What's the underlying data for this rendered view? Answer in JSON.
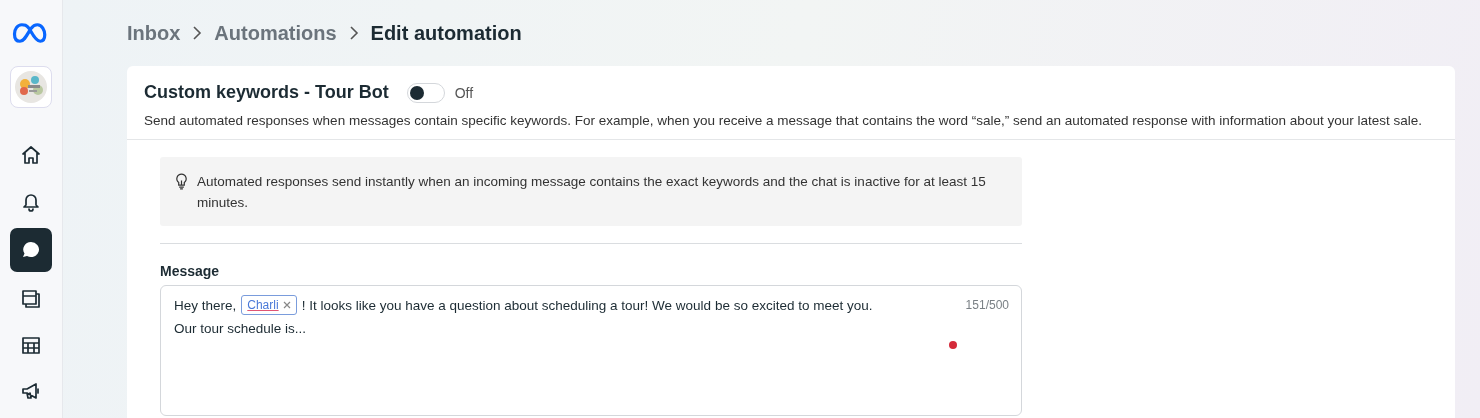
{
  "sidebar": {
    "nav_items": [
      {
        "selected": false
      },
      {
        "selected": false
      },
      {
        "selected": true
      },
      {
        "selected": false
      },
      {
        "selected": false
      },
      {
        "selected": false
      }
    ]
  },
  "breadcrumb": [
    {
      "label": "Inbox",
      "current": false
    },
    {
      "label": "Automations",
      "current": false
    },
    {
      "label": "Edit automation",
      "current": true
    }
  ],
  "automation": {
    "title": "Custom keywords - Tour Bot",
    "toggle": {
      "on": false,
      "label": "Off"
    },
    "description": "Send automated responses when messages contain specific keywords. For example, when you receive a message that contains the word “sale,” send an automated response with information about your latest sale."
  },
  "tip": "Automated responses send instantly when an incoming message contains the exact keywords and the chat is inactive for at least 15 minutes.",
  "message": {
    "label": "Message",
    "before_token": "Hey there,",
    "token": "Charli",
    "after_token": "! It looks like you have a question about scheduling a tour! We would be so excited to meet you.",
    "line_2": "Our tour schedule is...",
    "counter": "151/500"
  }
}
